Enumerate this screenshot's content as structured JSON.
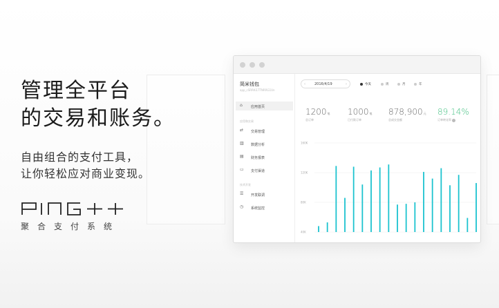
{
  "hero": {
    "headline_line1": "管理全平台",
    "headline_line2": "的交易和账务。",
    "subline_line1": "自由组合的支付工具，",
    "subline_line2": "让你轻松应对商业变现。"
  },
  "logo": {
    "wordmark": "PING++",
    "subtitle": "聚合支付系统"
  },
  "app": {
    "name": "简米钱包",
    "app_id": "app_cSRRKi1TTNRRG1Un",
    "nav": [
      {
        "label": "应用首页",
        "icon": "home-icon"
      },
      {
        "group": "应用和交易"
      },
      {
        "label": "交易管理",
        "icon": "transactions-icon"
      },
      {
        "label": "数据分析",
        "icon": "analytics-icon"
      },
      {
        "label": "财务报表",
        "icon": "report-icon"
      },
      {
        "label": "支付渠道",
        "icon": "channel-icon"
      },
      {
        "group": "技术开发"
      },
      {
        "label": "开发联调",
        "icon": "develop-icon"
      },
      {
        "label": "系统监控",
        "icon": "monitor-icon"
      }
    ]
  },
  "toolbar": {
    "date": "2016/4/19",
    "ranges": [
      "今天",
      "周",
      "月",
      "年"
    ],
    "active_range": 0
  },
  "stats": [
    {
      "value": "1200",
      "unit": "笔",
      "label": "总订单"
    },
    {
      "value": "1000",
      "unit": "笔",
      "label": "已付款订单"
    },
    {
      "value": "878,900",
      "unit": "元",
      "label": "总成交金额"
    },
    {
      "value": "89.14%",
      "unit": "",
      "label": "订单转化率"
    }
  ],
  "colors": {
    "bar": "#1bc3cf",
    "accent_green": "#3fbf7f"
  },
  "chart_data": {
    "type": "bar",
    "y_ticks": [
      "160K",
      "120K",
      "80K",
      "40K"
    ],
    "ylim": [
      40,
      160
    ],
    "values": [
      48,
      53,
      129,
      86,
      128,
      104,
      123,
      127,
      131,
      77,
      78,
      80,
      121,
      112,
      126,
      103,
      117,
      59,
      106
    ],
    "grid": true
  }
}
